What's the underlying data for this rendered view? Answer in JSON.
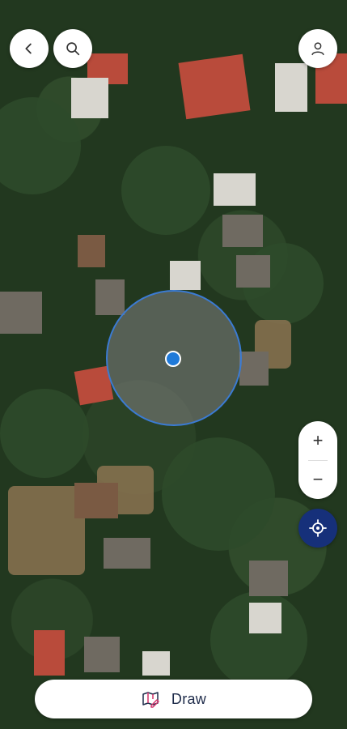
{
  "map": {
    "type": "satellite"
  },
  "top_bar": {
    "back_icon": "chevron-left-icon",
    "search_icon": "search-icon",
    "profile_icon": "user-icon"
  },
  "zoom": {
    "in_label": "+",
    "out_label": "−"
  },
  "locate": {
    "icon": "crosshair-icon"
  },
  "draw": {
    "label": "Draw",
    "icon": "draw-icon"
  },
  "colors": {
    "accent": "#16307a",
    "location_dot": "#1f7ad9",
    "radius_stroke": "#3b7bd3",
    "draw_icon": "#d6336c"
  }
}
